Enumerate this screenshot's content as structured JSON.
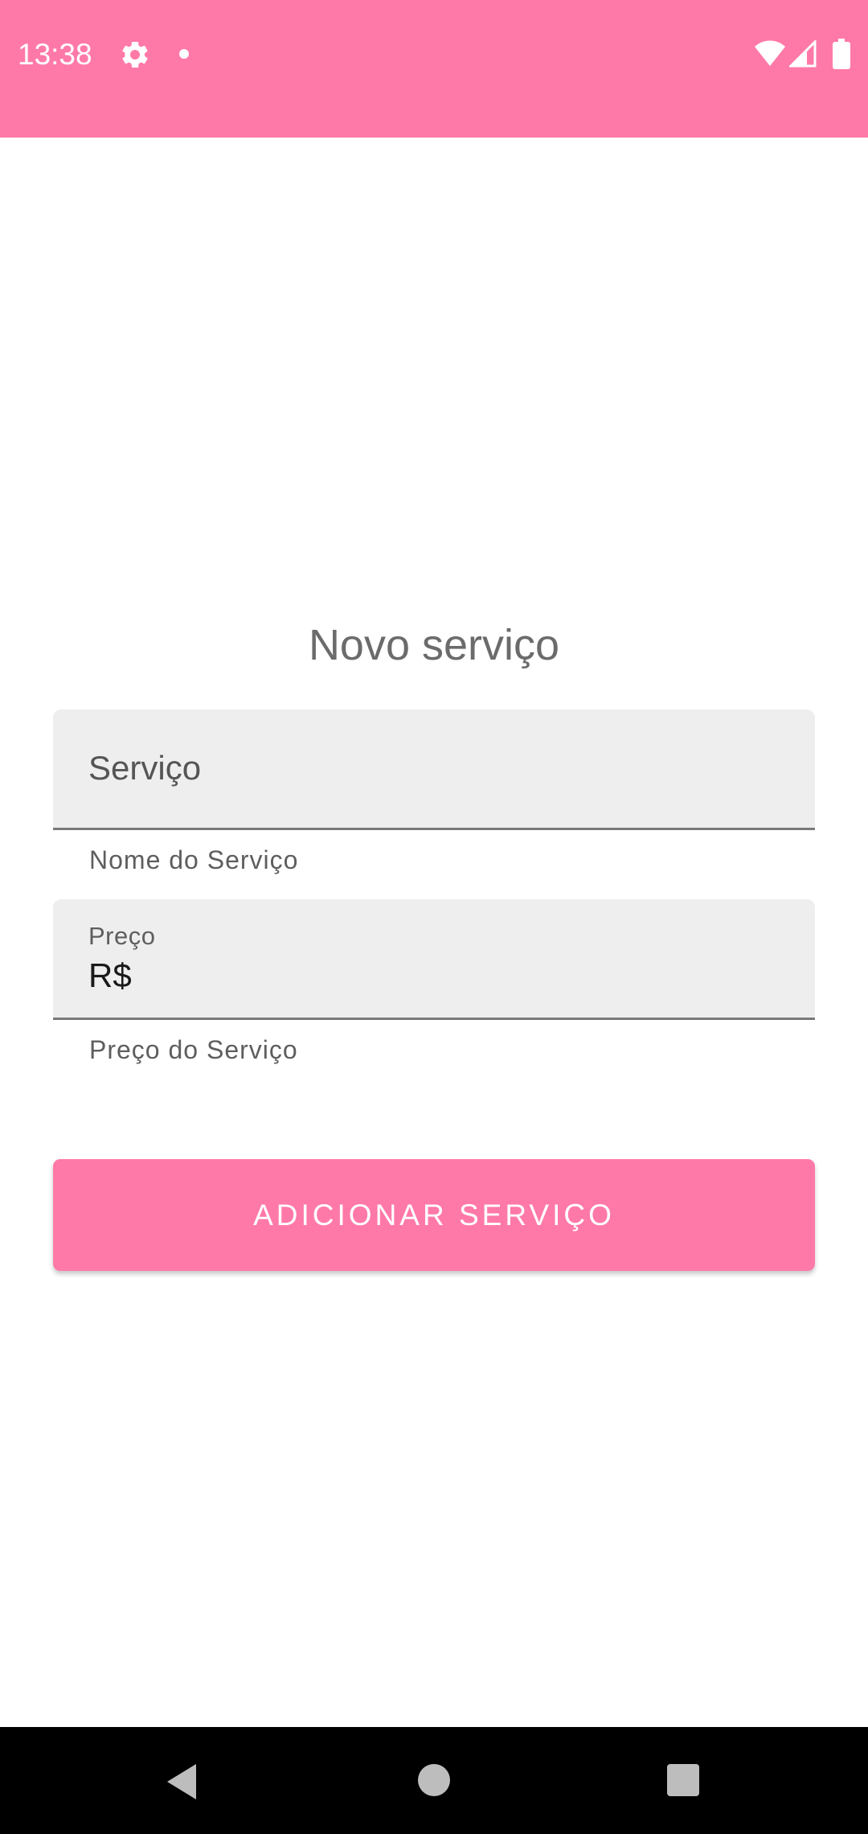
{
  "status_bar": {
    "time": "13:38",
    "icons": [
      "gear-icon",
      "notification-dot-icon",
      "wifi-icon",
      "signal-icon",
      "battery-icon"
    ],
    "background_color": "#FF79A8"
  },
  "page": {
    "title": "Novo serviço"
  },
  "form": {
    "service_field": {
      "placeholder": "Serviço",
      "value": "",
      "helper": "Nome do Serviço"
    },
    "price_field": {
      "label": "Preço",
      "value": "R$",
      "helper": "Preço do Serviço"
    },
    "submit_label": "ADICIONAR SERVIÇO"
  },
  "nav_bar": {
    "icons": [
      "back-icon",
      "home-icon",
      "recents-icon"
    ]
  },
  "colors": {
    "accent": "#FF79A8",
    "field_background": "#eeeeee"
  }
}
